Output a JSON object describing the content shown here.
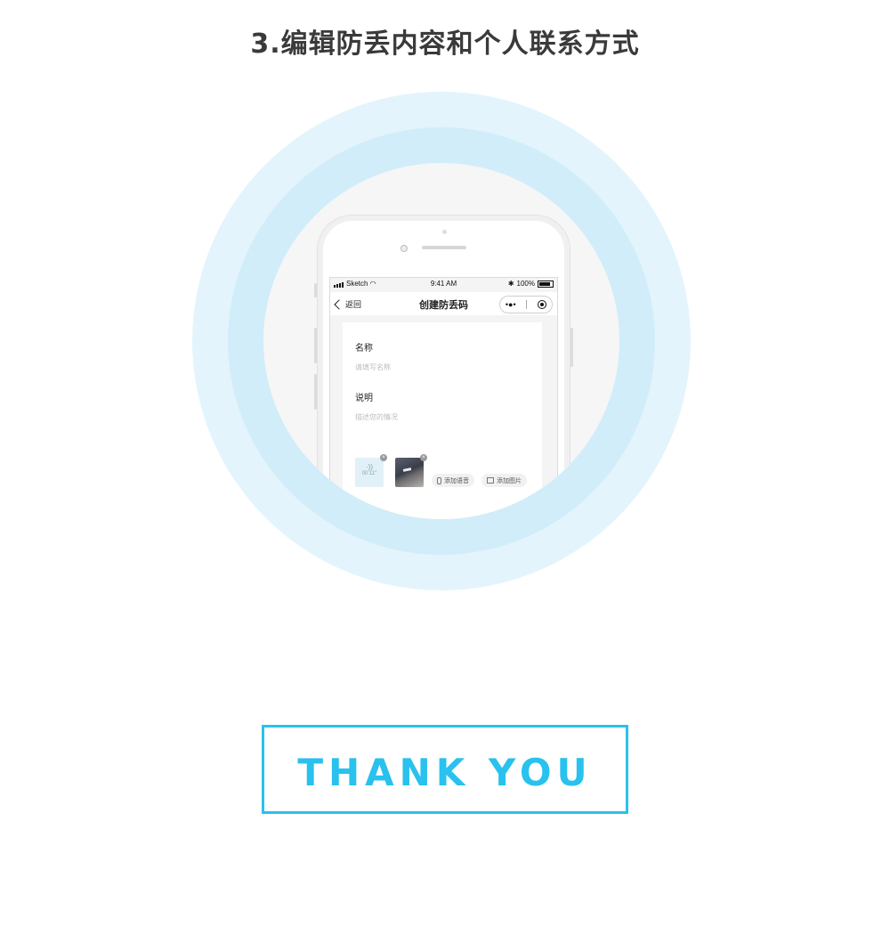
{
  "title": "3.编辑防丢内容和个人联系方式",
  "phone": {
    "statusbar": {
      "carrier": "Sketch",
      "time": "9:41 AM",
      "battery": "100%"
    },
    "navbar": {
      "back_label": "返回",
      "title": "创建防丢码",
      "capsule_more": "•●•"
    },
    "form": {
      "name_label": "名称",
      "name_placeholder": "请填写名称",
      "desc_label": "说明",
      "desc_placeholder": "描述您的情况",
      "voice_duration": "00:11''",
      "voice_wave": "·))",
      "delete_glyph": "×",
      "add_voice": "添加语音",
      "add_image": "添加图片"
    }
  },
  "footer": {
    "thank_you": "THANK YOU"
  },
  "colors": {
    "accent": "#29c1ee",
    "ring_outer": "#e3f4fc",
    "ring_mid": "#d1edf9",
    "ring_inner": "#f6f6f6"
  }
}
